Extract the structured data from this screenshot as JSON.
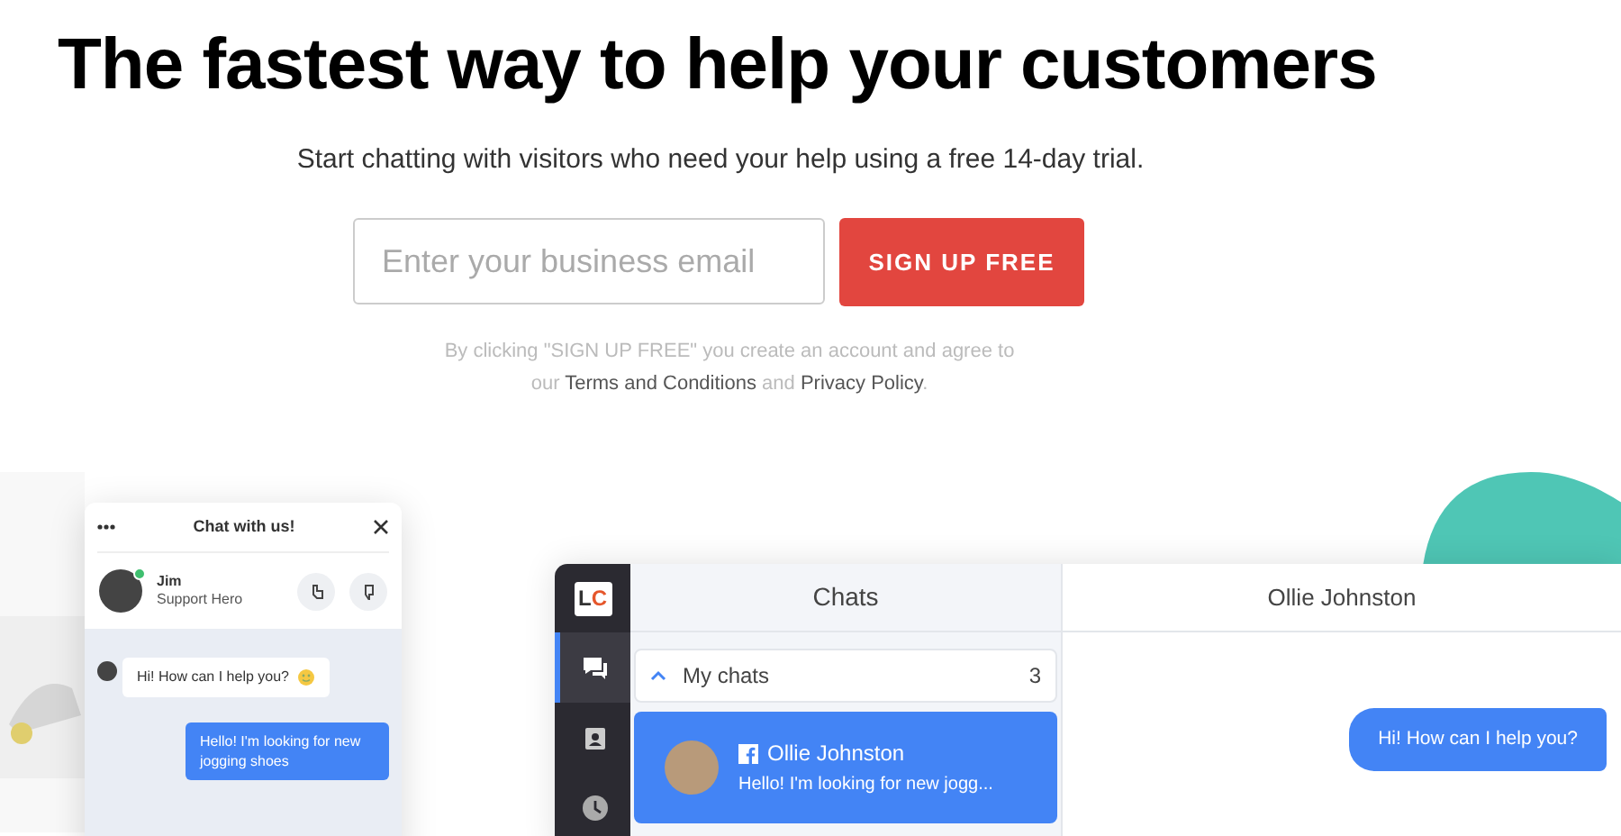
{
  "hero": {
    "headline": "The fastest way to help your customers",
    "subtitle": "Start chatting with visitors who need your help using a free 14-day trial."
  },
  "signup": {
    "email_placeholder": "Enter your business email",
    "button": "SIGN UP FREE"
  },
  "disclaimer": [
    {
      "kind": "text",
      "text": "By clicking \"SIGN UP FREE\" you create an account and agree to our "
    },
    {
      "kind": "link",
      "text": "Terms and Conditions"
    },
    {
      "kind": "text",
      "text": " and "
    },
    {
      "kind": "link",
      "text": "Privacy Policy"
    },
    {
      "kind": "text",
      "text": "."
    }
  ],
  "widget": {
    "title": "Chat with us!",
    "agent": {
      "name": "Jim",
      "role": "Support Hero",
      "online": true
    },
    "messages": [
      {
        "kind": "agent",
        "text": "Hi! How can I help you?"
      },
      {
        "kind": "visitor",
        "text": "Hello! I'm looking for new jogging shoes"
      }
    ]
  },
  "app": {
    "logo": [
      "L",
      "C"
    ],
    "sidebar": [
      {
        "kind": "chats",
        "selected": true
      },
      {
        "kind": "customers",
        "selected": false
      },
      {
        "kind": "history",
        "selected": false
      }
    ],
    "chats_title": "Chats",
    "group": {
      "label": "My chats",
      "count": "3",
      "expanded": true
    },
    "chats": [
      {
        "name": "Ollie Johnston",
        "preview": "Hello! I'm looking for new jogg...",
        "kind": "facebook",
        "selected": true
      }
    ],
    "conversation": {
      "title": "Ollie Johnston",
      "messages": [
        {
          "kind": "agent",
          "text": "Hi! How can I help you?"
        }
      ]
    }
  }
}
